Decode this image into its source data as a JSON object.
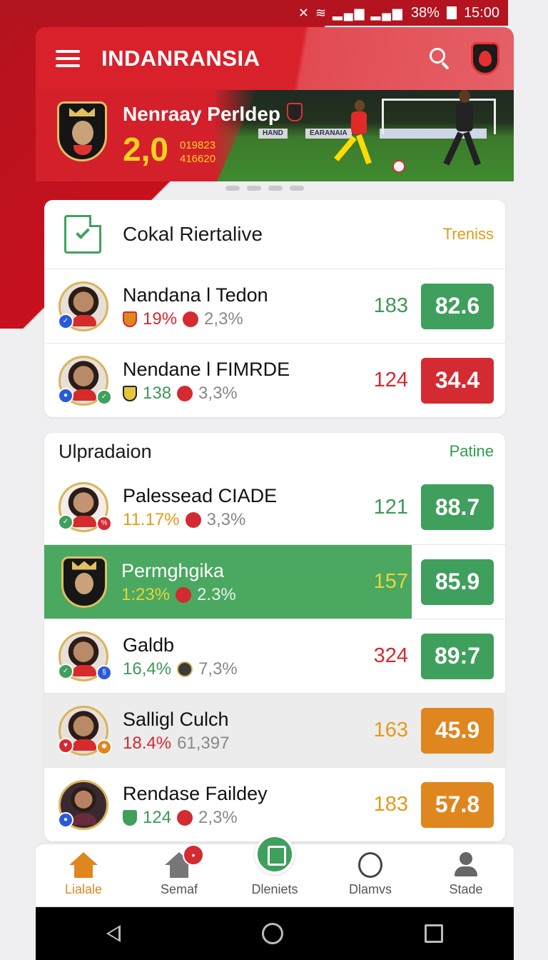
{
  "status_bar": {
    "icons": "✕ ≋ ▂▄▆ ▂▄▆",
    "battery": "38%",
    "time": "15:00"
  },
  "app": {
    "title": "INDANRANSIA"
  },
  "banner": {
    "title": "Nenraay Perldep",
    "score": "2,0",
    "sub_line1": "019823",
    "sub_line2": "416620",
    "board1": "HAND",
    "board2": "EARANAIA"
  },
  "section1": {
    "title": "Cokal Riertalive",
    "link": "Treniss",
    "rows": [
      {
        "name": "Nandana l Tedon",
        "pct1": "19%",
        "pct2": "2,3%",
        "num": "183",
        "score": "82.6"
      },
      {
        "name": "Nendane l FIMRDE",
        "pct1": "138",
        "pct2": "3,3%",
        "num": "124",
        "score": "34.4"
      }
    ]
  },
  "section2": {
    "title": "Ulpradaion",
    "link": "Patine",
    "rows": [
      {
        "name": "Palessead CIADE",
        "pct1": "11.17%",
        "pct2": "3,3%",
        "num": "121",
        "score": "88.7"
      },
      {
        "name": "Permghgika",
        "pct1": "1:23%",
        "pct2": "2.3%",
        "num": "157",
        "score": "85.9"
      },
      {
        "name": "Galdb",
        "pct1": "16,4%",
        "pct2": "7,3%",
        "num": "324",
        "score": "89:7"
      },
      {
        "name": "Salligl Culch",
        "pct1": "18.4%",
        "pct2": "61,397",
        "num": "163",
        "score": "45.9"
      },
      {
        "name": "Rendase Faildey",
        "pct1": "124",
        "pct2": "2,3%",
        "num": "183",
        "score": "57.8"
      }
    ]
  },
  "bottom_nav": {
    "items": [
      {
        "label": "Lialale"
      },
      {
        "label": "Semaf"
      },
      {
        "label": "Dleniets"
      },
      {
        "label": "Dlamvs"
      },
      {
        "label": "Stade"
      }
    ]
  },
  "colors": {
    "brand_red": "#d9212c",
    "green": "#3f9f5c",
    "red": "#d42a31",
    "orange": "#e0861f",
    "highlight_green": "#4aa861"
  },
  "icons": [
    "hamburger-icon",
    "search-icon",
    "team-badge-icon",
    "document-check-icon",
    "home-icon",
    "notification-badge",
    "medal-icon",
    "person-icon",
    "back-icon",
    "home-circle-icon",
    "recents-icon"
  ]
}
